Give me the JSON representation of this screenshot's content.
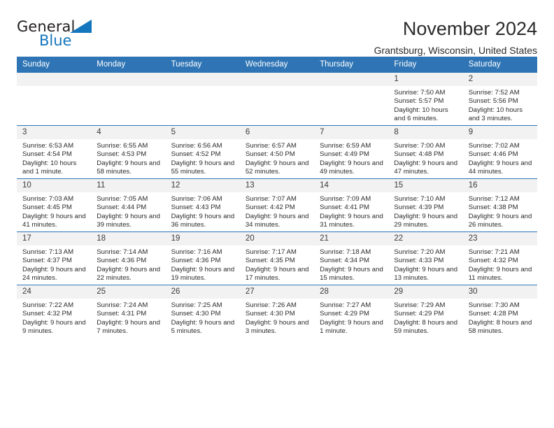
{
  "brand": {
    "name_part1": "General",
    "name_part2": "Blue",
    "accent_color": "#1476bd"
  },
  "header": {
    "title": "November 2024",
    "location": "Grantsburg, Wisconsin, United States"
  },
  "theme": {
    "header_blue": "#2f75b5",
    "daynum_band": "#f2f2f2"
  },
  "weekdays": [
    "Sunday",
    "Monday",
    "Tuesday",
    "Wednesday",
    "Thursday",
    "Friday",
    "Saturday"
  ],
  "weeks": [
    [
      {
        "day": "",
        "sunrise": "",
        "sunset": "",
        "daylight": "",
        "empty": true
      },
      {
        "day": "",
        "sunrise": "",
        "sunset": "",
        "daylight": "",
        "empty": true
      },
      {
        "day": "",
        "sunrise": "",
        "sunset": "",
        "daylight": "",
        "empty": true
      },
      {
        "day": "",
        "sunrise": "",
        "sunset": "",
        "daylight": "",
        "empty": true
      },
      {
        "day": "",
        "sunrise": "",
        "sunset": "",
        "daylight": "",
        "empty": true
      },
      {
        "day": "1",
        "sunrise": "Sunrise: 7:50 AM",
        "sunset": "Sunset: 5:57 PM",
        "daylight": "Daylight: 10 hours and 6 minutes."
      },
      {
        "day": "2",
        "sunrise": "Sunrise: 7:52 AM",
        "sunset": "Sunset: 5:56 PM",
        "daylight": "Daylight: 10 hours and 3 minutes."
      }
    ],
    [
      {
        "day": "3",
        "sunrise": "Sunrise: 6:53 AM",
        "sunset": "Sunset: 4:54 PM",
        "daylight": "Daylight: 10 hours and 1 minute."
      },
      {
        "day": "4",
        "sunrise": "Sunrise: 6:55 AM",
        "sunset": "Sunset: 4:53 PM",
        "daylight": "Daylight: 9 hours and 58 minutes."
      },
      {
        "day": "5",
        "sunrise": "Sunrise: 6:56 AM",
        "sunset": "Sunset: 4:52 PM",
        "daylight": "Daylight: 9 hours and 55 minutes."
      },
      {
        "day": "6",
        "sunrise": "Sunrise: 6:57 AM",
        "sunset": "Sunset: 4:50 PM",
        "daylight": "Daylight: 9 hours and 52 minutes."
      },
      {
        "day": "7",
        "sunrise": "Sunrise: 6:59 AM",
        "sunset": "Sunset: 4:49 PM",
        "daylight": "Daylight: 9 hours and 49 minutes."
      },
      {
        "day": "8",
        "sunrise": "Sunrise: 7:00 AM",
        "sunset": "Sunset: 4:48 PM",
        "daylight": "Daylight: 9 hours and 47 minutes."
      },
      {
        "day": "9",
        "sunrise": "Sunrise: 7:02 AM",
        "sunset": "Sunset: 4:46 PM",
        "daylight": "Daylight: 9 hours and 44 minutes."
      }
    ],
    [
      {
        "day": "10",
        "sunrise": "Sunrise: 7:03 AM",
        "sunset": "Sunset: 4:45 PM",
        "daylight": "Daylight: 9 hours and 41 minutes."
      },
      {
        "day": "11",
        "sunrise": "Sunrise: 7:05 AM",
        "sunset": "Sunset: 4:44 PM",
        "daylight": "Daylight: 9 hours and 39 minutes."
      },
      {
        "day": "12",
        "sunrise": "Sunrise: 7:06 AM",
        "sunset": "Sunset: 4:43 PM",
        "daylight": "Daylight: 9 hours and 36 minutes."
      },
      {
        "day": "13",
        "sunrise": "Sunrise: 7:07 AM",
        "sunset": "Sunset: 4:42 PM",
        "daylight": "Daylight: 9 hours and 34 minutes."
      },
      {
        "day": "14",
        "sunrise": "Sunrise: 7:09 AM",
        "sunset": "Sunset: 4:41 PM",
        "daylight": "Daylight: 9 hours and 31 minutes."
      },
      {
        "day": "15",
        "sunrise": "Sunrise: 7:10 AM",
        "sunset": "Sunset: 4:39 PM",
        "daylight": "Daylight: 9 hours and 29 minutes."
      },
      {
        "day": "16",
        "sunrise": "Sunrise: 7:12 AM",
        "sunset": "Sunset: 4:38 PM",
        "daylight": "Daylight: 9 hours and 26 minutes."
      }
    ],
    [
      {
        "day": "17",
        "sunrise": "Sunrise: 7:13 AM",
        "sunset": "Sunset: 4:37 PM",
        "daylight": "Daylight: 9 hours and 24 minutes."
      },
      {
        "day": "18",
        "sunrise": "Sunrise: 7:14 AM",
        "sunset": "Sunset: 4:36 PM",
        "daylight": "Daylight: 9 hours and 22 minutes."
      },
      {
        "day": "19",
        "sunrise": "Sunrise: 7:16 AM",
        "sunset": "Sunset: 4:36 PM",
        "daylight": "Daylight: 9 hours and 19 minutes."
      },
      {
        "day": "20",
        "sunrise": "Sunrise: 7:17 AM",
        "sunset": "Sunset: 4:35 PM",
        "daylight": "Daylight: 9 hours and 17 minutes."
      },
      {
        "day": "21",
        "sunrise": "Sunrise: 7:18 AM",
        "sunset": "Sunset: 4:34 PM",
        "daylight": "Daylight: 9 hours and 15 minutes."
      },
      {
        "day": "22",
        "sunrise": "Sunrise: 7:20 AM",
        "sunset": "Sunset: 4:33 PM",
        "daylight": "Daylight: 9 hours and 13 minutes."
      },
      {
        "day": "23",
        "sunrise": "Sunrise: 7:21 AM",
        "sunset": "Sunset: 4:32 PM",
        "daylight": "Daylight: 9 hours and 11 minutes."
      }
    ],
    [
      {
        "day": "24",
        "sunrise": "Sunrise: 7:22 AM",
        "sunset": "Sunset: 4:32 PM",
        "daylight": "Daylight: 9 hours and 9 minutes."
      },
      {
        "day": "25",
        "sunrise": "Sunrise: 7:24 AM",
        "sunset": "Sunset: 4:31 PM",
        "daylight": "Daylight: 9 hours and 7 minutes."
      },
      {
        "day": "26",
        "sunrise": "Sunrise: 7:25 AM",
        "sunset": "Sunset: 4:30 PM",
        "daylight": "Daylight: 9 hours and 5 minutes."
      },
      {
        "day": "27",
        "sunrise": "Sunrise: 7:26 AM",
        "sunset": "Sunset: 4:30 PM",
        "daylight": "Daylight: 9 hours and 3 minutes."
      },
      {
        "day": "28",
        "sunrise": "Sunrise: 7:27 AM",
        "sunset": "Sunset: 4:29 PM",
        "daylight": "Daylight: 9 hours and 1 minute."
      },
      {
        "day": "29",
        "sunrise": "Sunrise: 7:29 AM",
        "sunset": "Sunset: 4:29 PM",
        "daylight": "Daylight: 8 hours and 59 minutes."
      },
      {
        "day": "30",
        "sunrise": "Sunrise: 7:30 AM",
        "sunset": "Sunset: 4:28 PM",
        "daylight": "Daylight: 8 hours and 58 minutes."
      }
    ]
  ]
}
